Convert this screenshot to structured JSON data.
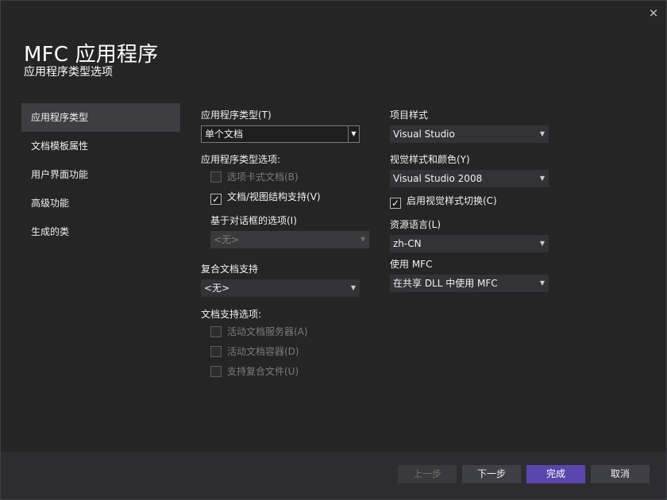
{
  "window": {
    "title": "MFC 应用程序",
    "subtitle": "应用程序类型选项",
    "close_icon": "×"
  },
  "nav": {
    "items": [
      "应用程序类型",
      "文档模板属性",
      "用户界面功能",
      "高级功能",
      "生成的类"
    ],
    "active_index": 0
  },
  "left": {
    "app_type_label": "应用程序类型(T)",
    "app_type_value": "单个文档",
    "app_type_options_label": "应用程序类型选项:",
    "tabbed_docs": {
      "label": "选项卡式文档(B)",
      "checked": false,
      "enabled": false
    },
    "doc_view": {
      "label": "文档/视图结构支持(V)",
      "checked": true,
      "enabled": true
    },
    "dialog_options_label": "基于对话框的选项(I)",
    "dialog_options_value": "<无>",
    "compound_label": "复合文档支持",
    "compound_value": "<无>",
    "doc_support_label": "文档支持选项:",
    "active_server": {
      "label": "活动文档服务器(A)",
      "checked": false,
      "enabled": false
    },
    "active_container": {
      "label": "活动文档容器(D)",
      "checked": false,
      "enabled": false
    },
    "compound_files": {
      "label": "支持复合文件(U)",
      "checked": false,
      "enabled": false
    }
  },
  "right": {
    "project_style_label": "项目样式",
    "project_style_value": "Visual Studio",
    "visual_style_label": "视觉样式和颜色(Y)",
    "visual_style_value": "Visual Studio 2008",
    "style_switch": {
      "label": "启用视觉样式切换(C)",
      "checked": true,
      "enabled": true
    },
    "resource_lang_label": "资源语言(L)",
    "resource_lang_value": "zh-CN",
    "use_mfc_label": "使用 MFC",
    "use_mfc_value": "在共享 DLL 中使用 MFC"
  },
  "footer": {
    "prev_label": "上一步",
    "next_label": "下一步",
    "finish_label": "完成",
    "cancel_label": "取消"
  },
  "colors": {
    "background": "#252526",
    "nav_active": "#3e3e42",
    "combo": "#333337",
    "primary_button": "#5b46ad"
  },
  "icons": {
    "close": "close-icon",
    "dropdown": "chevron-down-icon",
    "check": "checkmark-icon"
  }
}
